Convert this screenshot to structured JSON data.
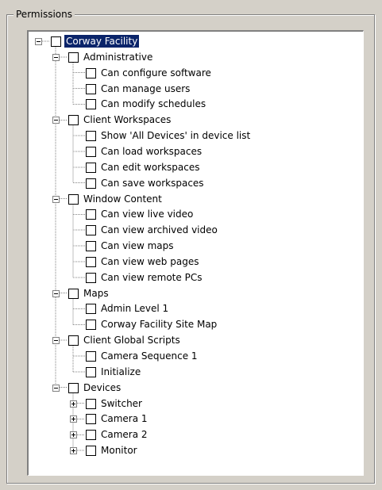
{
  "groupbox": {
    "title": "Permissions"
  },
  "tree": {
    "root": {
      "label": "Corway Facility",
      "expanded": true,
      "checked": false,
      "selected": true
    },
    "categories": [
      {
        "label": "Administrative",
        "expanded": true,
        "checked": false,
        "children": [
          {
            "label": "Can configure software",
            "checked": false
          },
          {
            "label": "Can manage users",
            "checked": false
          },
          {
            "label": "Can modify schedules",
            "checked": false
          }
        ]
      },
      {
        "label": "Client Workspaces",
        "expanded": true,
        "checked": false,
        "children": [
          {
            "label": "Show 'All Devices' in device list",
            "checked": false
          },
          {
            "label": "Can load workspaces",
            "checked": false
          },
          {
            "label": "Can edit workspaces",
            "checked": false
          },
          {
            "label": "Can save workspaces",
            "checked": false
          }
        ]
      },
      {
        "label": "Window Content",
        "expanded": true,
        "checked": false,
        "children": [
          {
            "label": "Can view live video",
            "checked": false
          },
          {
            "label": "Can view archived video",
            "checked": false
          },
          {
            "label": "Can view maps",
            "checked": false
          },
          {
            "label": "Can view web pages",
            "checked": false
          },
          {
            "label": "Can view remote PCs",
            "checked": false
          }
        ]
      },
      {
        "label": "Maps",
        "expanded": true,
        "checked": false,
        "children": [
          {
            "label": "Admin Level 1",
            "checked": false
          },
          {
            "label": "Corway Facility Site Map",
            "checked": false
          }
        ]
      },
      {
        "label": "Client Global Scripts",
        "expanded": true,
        "checked": false,
        "children": [
          {
            "label": "Camera Sequence 1",
            "checked": false
          },
          {
            "label": "Initialize",
            "checked": false
          }
        ]
      },
      {
        "label": "Devices",
        "expanded": true,
        "checked": false,
        "children": [
          {
            "label": "Switcher",
            "checked": false,
            "expandable": true
          },
          {
            "label": "Camera 1",
            "checked": false,
            "expandable": true
          },
          {
            "label": "Camera 2",
            "checked": false,
            "expandable": true
          },
          {
            "label": "Monitor",
            "checked": false,
            "expandable": true
          }
        ]
      }
    ]
  },
  "colors": {
    "dialog_bg": "#d4d0c8",
    "selection_bg": "#0a246a",
    "tree_bg": "#ffffff"
  }
}
